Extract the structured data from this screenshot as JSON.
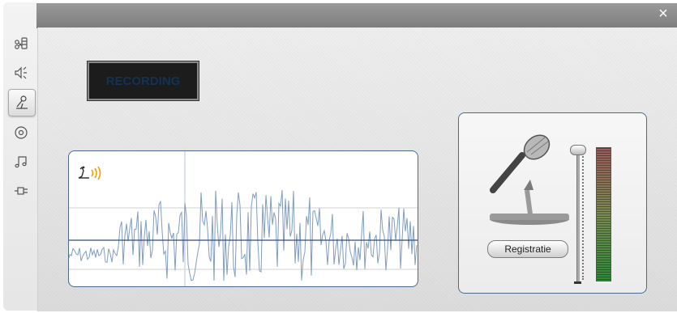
{
  "window": {
    "close_label": "×"
  },
  "sidebar": {
    "items": [
      {
        "icon": "edit-media-icon",
        "active": false
      },
      {
        "icon": "speaker-icon",
        "active": false
      },
      {
        "icon": "microphone-icon",
        "active": true
      },
      {
        "icon": "disc-icon",
        "active": false
      },
      {
        "icon": "music-note-icon",
        "active": false
      },
      {
        "icon": "plug-icon",
        "active": false
      }
    ]
  },
  "lcd": {
    "text": "RECORDING"
  },
  "mic_panel": {
    "record_button_label": "Registratie",
    "level_fraction": 0.98
  },
  "colors": {
    "frame_blue": "#4a6a92",
    "accent_orange": "#f0a000",
    "wave": "#7f9cc4"
  }
}
